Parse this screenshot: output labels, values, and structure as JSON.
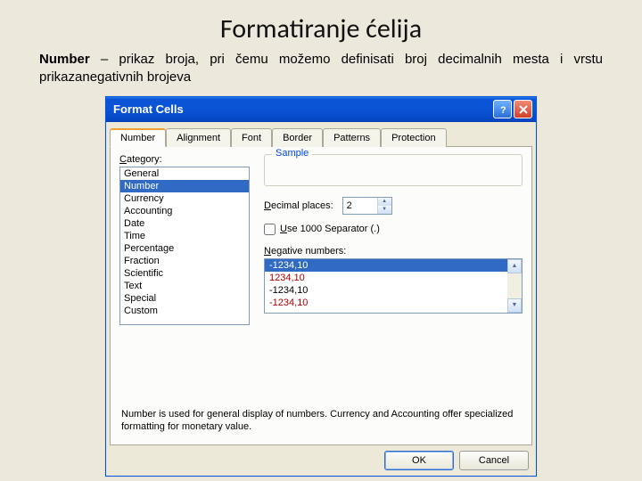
{
  "slide": {
    "title": "Formatiranje ćelija",
    "desc_bold": "Number",
    "desc_rest": " – prikaz broja, pri čemu možemo definisati broj decimalnih mesta i vrstu prikazanegativnih brojeva"
  },
  "dialog": {
    "title": "Format Cells",
    "tabs": [
      "Number",
      "Alignment",
      "Font",
      "Border",
      "Patterns",
      "Protection"
    ],
    "active_tab": "Number",
    "category_label": "Category:",
    "categories": [
      "General",
      "Number",
      "Currency",
      "Accounting",
      "Date",
      "Time",
      "Percentage",
      "Fraction",
      "Scientific",
      "Text",
      "Special",
      "Custom"
    ],
    "selected_category": "Number",
    "sample_label": "Sample",
    "decimal_label": "Decimal places:",
    "decimal_value": "2",
    "separator_label": "Use 1000 Separator (.)",
    "negative_label": "Negative numbers:",
    "negative_options": [
      {
        "text": "-1234,10",
        "red": false,
        "sel": true
      },
      {
        "text": "1234,10",
        "red": true,
        "sel": false
      },
      {
        "text": "-1234,10",
        "red": false,
        "sel": false
      },
      {
        "text": "-1234,10",
        "red": true,
        "sel": false
      }
    ],
    "hint": "Number is used for general display of numbers.  Currency and Accounting offer specialized formatting for monetary value.",
    "ok": "OK",
    "cancel": "Cancel"
  }
}
